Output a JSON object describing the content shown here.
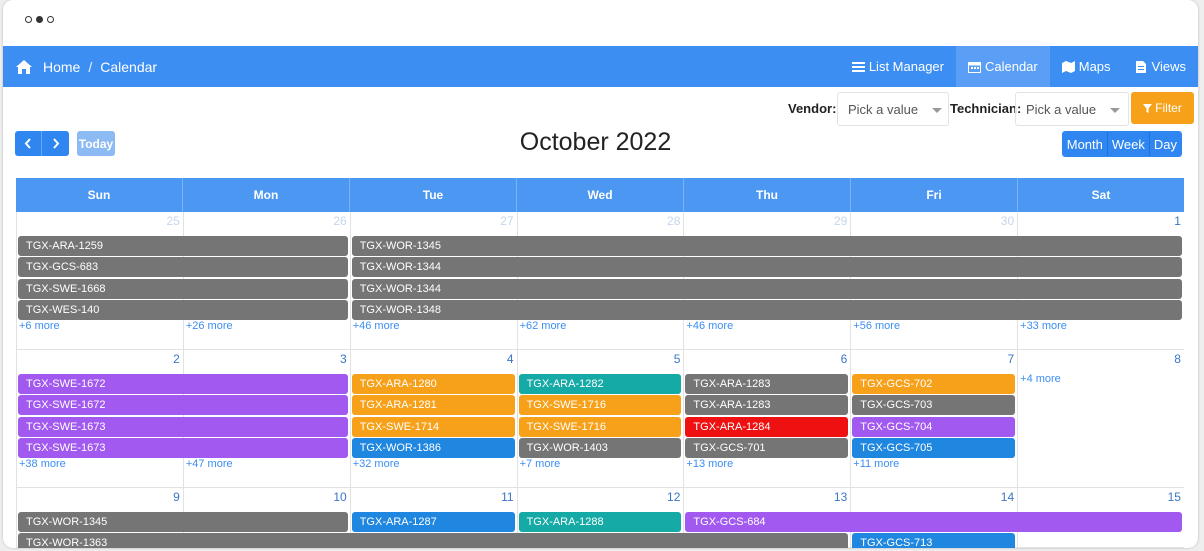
{
  "window": {
    "dots": [
      "dot-1",
      "dot-2",
      "dot-3"
    ]
  },
  "breadcrumb": {
    "home": "Home",
    "separator": "/",
    "current": "Calendar",
    "icon": "home-icon"
  },
  "nav": {
    "list_manager": "List Manager",
    "calendar": "Calendar",
    "maps": "Maps",
    "views": "Views"
  },
  "filters": {
    "vendor_label": "Vendor:",
    "vendor_value": "Pick a value",
    "technician_label": "Technician:",
    "technician_value": "Pick a value",
    "filter_button": "Filter"
  },
  "toolbar": {
    "prev": "‹",
    "next": "›",
    "today": "Today",
    "title": "October 2022",
    "views": [
      "Month",
      "Week",
      "Day"
    ]
  },
  "colors": {
    "gray": "#757575",
    "purple": "#a259f0",
    "orange": "#f7a11a",
    "teal": "#16aaa6",
    "blue": "#1f87e0",
    "red": "#ef1111",
    "accent": "#3c8ef3"
  },
  "calendar": {
    "weekdays": [
      "Sun",
      "Mon",
      "Tue",
      "Wed",
      "Thu",
      "Fri",
      "Sat"
    ],
    "weeks": [
      {
        "days": [
          "25",
          "26",
          "27",
          "28",
          "29",
          "30",
          "1"
        ],
        "other_month": [
          true,
          true,
          true,
          true,
          true,
          true,
          false
        ],
        "events": [
          {
            "label": "TGX-ARA-1259",
            "color": "gray",
            "start": 0,
            "span": 2,
            "row": 0
          },
          {
            "label": "TGX-GCS-683",
            "color": "gray",
            "start": 0,
            "span": 2,
            "row": 1
          },
          {
            "label": "TGX-SWE-1668",
            "color": "gray",
            "start": 0,
            "span": 2,
            "row": 2
          },
          {
            "label": "TGX-WES-140",
            "color": "gray",
            "start": 0,
            "span": 2,
            "row": 3
          },
          {
            "label": "TGX-WOR-1345",
            "color": "gray",
            "start": 2,
            "span": 5,
            "row": 0
          },
          {
            "label": "TGX-WOR-1344",
            "color": "gray",
            "start": 2,
            "span": 5,
            "row": 1
          },
          {
            "label": "TGX-WOR-1344",
            "color": "gray",
            "start": 2,
            "span": 5,
            "row": 2
          },
          {
            "label": "TGX-WOR-1348",
            "color": "gray",
            "start": 2,
            "span": 5,
            "row": 3
          }
        ],
        "more": [
          "+6 more",
          "+26 more",
          "+46 more",
          "+62 more",
          "+46 more",
          "+56 more",
          "+33 more"
        ]
      },
      {
        "days": [
          "2",
          "3",
          "4",
          "5",
          "6",
          "7",
          "8"
        ],
        "other_month": [
          false,
          false,
          false,
          false,
          false,
          false,
          false
        ],
        "events": [
          {
            "label": "TGX-SWE-1672",
            "color": "purple",
            "start": 0,
            "span": 2,
            "row": 0
          },
          {
            "label": "TGX-SWE-1672",
            "color": "purple",
            "start": 0,
            "span": 2,
            "row": 1
          },
          {
            "label": "TGX-SWE-1673",
            "color": "purple",
            "start": 0,
            "span": 2,
            "row": 2
          },
          {
            "label": "TGX-SWE-1673",
            "color": "purple",
            "start": 0,
            "span": 2,
            "row": 3
          },
          {
            "label": "TGX-ARA-1280",
            "color": "orange",
            "start": 2,
            "span": 1,
            "row": 0
          },
          {
            "label": "TGX-ARA-1281",
            "color": "orange",
            "start": 2,
            "span": 1,
            "row": 1
          },
          {
            "label": "TGX-SWE-1714",
            "color": "orange",
            "start": 2,
            "span": 1,
            "row": 2
          },
          {
            "label": "TGX-WOR-1386",
            "color": "blue",
            "start": 2,
            "span": 1,
            "row": 3
          },
          {
            "label": "TGX-ARA-1282",
            "color": "teal",
            "start": 3,
            "span": 1,
            "row": 0
          },
          {
            "label": "TGX-SWE-1716",
            "color": "orange",
            "start": 3,
            "span": 1,
            "row": 1
          },
          {
            "label": "TGX-SWE-1716",
            "color": "orange",
            "start": 3,
            "span": 1,
            "row": 2
          },
          {
            "label": "TGX-WOR-1403",
            "color": "gray",
            "start": 3,
            "span": 1,
            "row": 3
          },
          {
            "label": "TGX-ARA-1283",
            "color": "gray",
            "start": 4,
            "span": 1,
            "row": 0
          },
          {
            "label": "TGX-ARA-1283",
            "color": "gray",
            "start": 4,
            "span": 1,
            "row": 1
          },
          {
            "label": "TGX-ARA-1284",
            "color": "red",
            "start": 4,
            "span": 1,
            "row": 2
          },
          {
            "label": "TGX-GCS-701",
            "color": "gray",
            "start": 4,
            "span": 1,
            "row": 3
          },
          {
            "label": "TGX-GCS-702",
            "color": "orange",
            "start": 5,
            "span": 1,
            "row": 0
          },
          {
            "label": "TGX-GCS-703",
            "color": "gray",
            "start": 5,
            "span": 1,
            "row": 1
          },
          {
            "label": "TGX-GCS-704",
            "color": "purple",
            "start": 5,
            "span": 1,
            "row": 2
          },
          {
            "label": "TGX-GCS-705",
            "color": "blue",
            "start": 5,
            "span": 1,
            "row": 3
          }
        ],
        "more": [
          "+38 more",
          "+47 more",
          "+32 more",
          "+7 more",
          "+13 more",
          "+11 more",
          "+4 more"
        ],
        "more_row": [
          4,
          4,
          4,
          4,
          4,
          4,
          0
        ]
      },
      {
        "days": [
          "9",
          "10",
          "11",
          "12",
          "13",
          "14",
          "15"
        ],
        "other_month": [
          false,
          false,
          false,
          false,
          false,
          false,
          false
        ],
        "events": [
          {
            "label": "TGX-WOR-1345",
            "color": "gray",
            "start": 0,
            "span": 2,
            "row": 0
          },
          {
            "label": "TGX-ARA-1287",
            "color": "blue",
            "start": 2,
            "span": 1,
            "row": 0
          },
          {
            "label": "TGX-ARA-1288",
            "color": "teal",
            "start": 3,
            "span": 1,
            "row": 0
          },
          {
            "label": "TGX-GCS-684",
            "color": "purple",
            "start": 4,
            "span": 3,
            "row": 0
          },
          {
            "label": "TGX-WOR-1363",
            "color": "gray",
            "start": 0,
            "span": 5,
            "row": 1
          },
          {
            "label": "TGX-GCS-713",
            "color": "blue",
            "start": 5,
            "span": 1,
            "row": 1
          }
        ],
        "more": []
      }
    ]
  }
}
